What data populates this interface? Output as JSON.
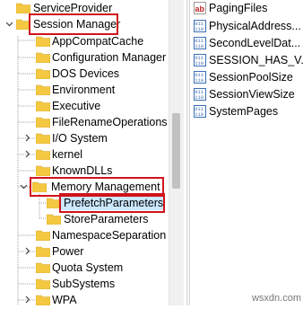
{
  "tree": {
    "items": [
      {
        "label": "ServiceProvider"
      },
      {
        "label": "Session Manager"
      },
      {
        "label": "AppCompatCache"
      },
      {
        "label": "Configuration Manager"
      },
      {
        "label": "DOS Devices"
      },
      {
        "label": "Environment"
      },
      {
        "label": "Executive"
      },
      {
        "label": "FileRenameOperations"
      },
      {
        "label": "I/O System"
      },
      {
        "label": "kernel"
      },
      {
        "label": "KnownDLLs"
      },
      {
        "label": "Memory Management"
      },
      {
        "label": "PrefetchParameters"
      },
      {
        "label": "StoreParameters"
      },
      {
        "label": "NamespaceSeparation"
      },
      {
        "label": "Power"
      },
      {
        "label": "Quota System"
      },
      {
        "label": "SubSystems"
      },
      {
        "label": "WPA"
      }
    ]
  },
  "values": {
    "items": [
      {
        "label": "PagingFiles",
        "icon": "ab-string-icon"
      },
      {
        "label": "PhysicalAddress...",
        "icon": "binary-value-icon"
      },
      {
        "label": "SecondLevelDat...",
        "icon": "binary-value-icon"
      },
      {
        "label": "SESSION_HAS_V...",
        "icon": "binary-value-icon"
      },
      {
        "label": "SessionPoolSize",
        "icon": "binary-value-icon"
      },
      {
        "label": "SessionViewSize",
        "icon": "binary-value-icon"
      },
      {
        "label": "SystemPages",
        "icon": "binary-value-icon"
      }
    ]
  },
  "watermark": "wsxdn.com",
  "colors": {
    "highlight": "#d0141b",
    "folder": "#f5c842",
    "selection": "#cce8ff"
  }
}
